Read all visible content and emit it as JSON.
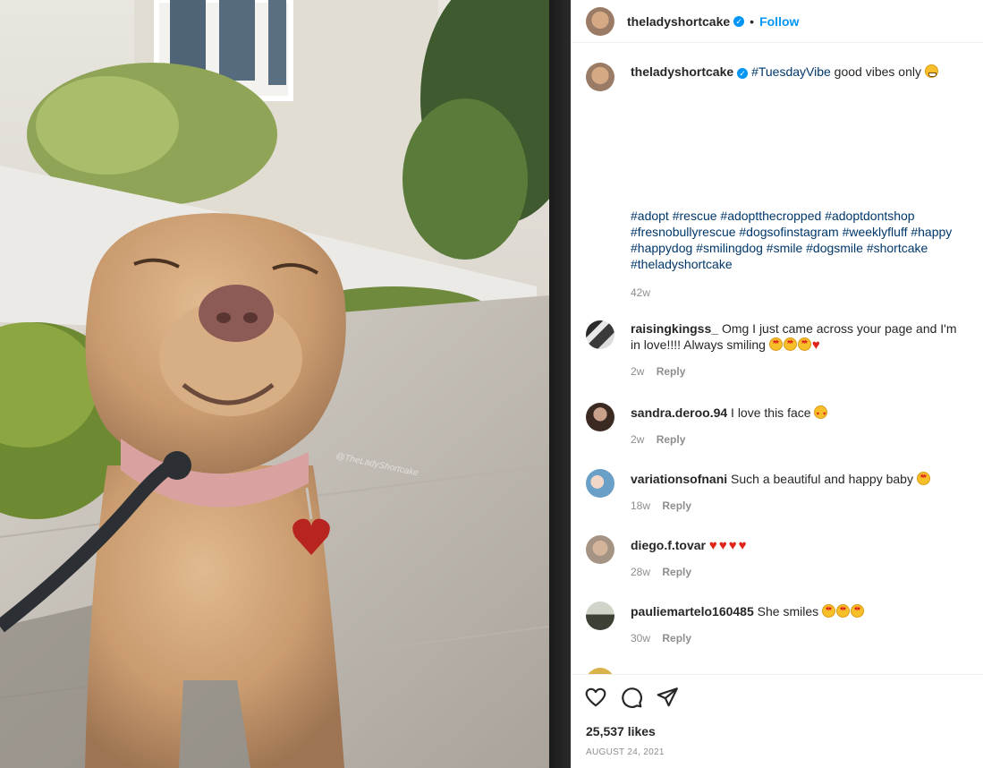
{
  "photo": {
    "watermark": "@TheLadyShortcake"
  },
  "header": {
    "username": "theladyshortcake",
    "separator": "•",
    "follow_label": "Follow"
  },
  "caption": {
    "username": "theladyshortcake",
    "hashtag": "#TuesdayVibe",
    "text": " good vibes only ",
    "tags": "#adopt #rescue #adoptthecropped #adoptdontshop #fresnobullyrescue #dogsofinstagram #weeklyfluff #happy #happydog #smilingdog #smile #dogsmile #shortcake #theladyshortcake",
    "time": "42w"
  },
  "comments": [
    {
      "username": "raisingkingss_",
      "text": "Omg I just came across your page and I'm in love!!!! Always smiling",
      "time": "2w",
      "reply": "Reply"
    },
    {
      "username": "sandra.deroo.94",
      "text": "I love this face",
      "time": "2w",
      "reply": "Reply"
    },
    {
      "username": "variationsofnani",
      "text": "Such a beautiful and happy baby",
      "time": "18w",
      "reply": "Reply"
    },
    {
      "username": "diego.f.tovar",
      "text": "",
      "time": "28w",
      "reply": "Reply"
    },
    {
      "username": "pauliemartelo160485",
      "text": "She smiles",
      "time": "30w",
      "reply": "Reply"
    }
  ],
  "footer": {
    "likes": "25,537 likes",
    "date": "August 24, 2021"
  },
  "colors": {
    "accent": "#0095f6",
    "hashtag": "#00376b",
    "muted": "#8e8e8e"
  },
  "icons": [
    "heart-icon",
    "comment-icon",
    "share-icon",
    "verified-badge-icon"
  ]
}
